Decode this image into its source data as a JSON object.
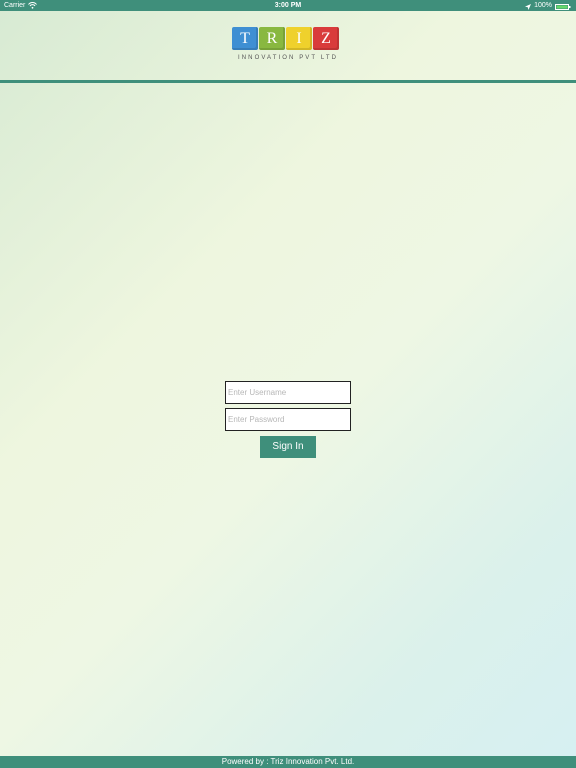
{
  "status_bar": {
    "carrier": "Carrier",
    "time": "3:00 PM",
    "battery_text": "100%",
    "icons": [
      "wifi-icon",
      "location-arrow-icon",
      "battery-icon"
    ]
  },
  "header": {
    "logo": {
      "letters": [
        "T",
        "R",
        "I",
        "Z"
      ],
      "letter_colors": [
        "#3f8fd3",
        "#89b840",
        "#efd12c",
        "#d93b3b"
      ],
      "tagline": "INNOVATION PVT LTD"
    },
    "accent_color": "#3f8f7b"
  },
  "login": {
    "username_placeholder": "Enter Username",
    "password_placeholder": "Enter Password",
    "sign_in_label": "Sign In"
  },
  "footer": {
    "text": "Powered by : Triz Innovation Pvt. Ltd."
  }
}
